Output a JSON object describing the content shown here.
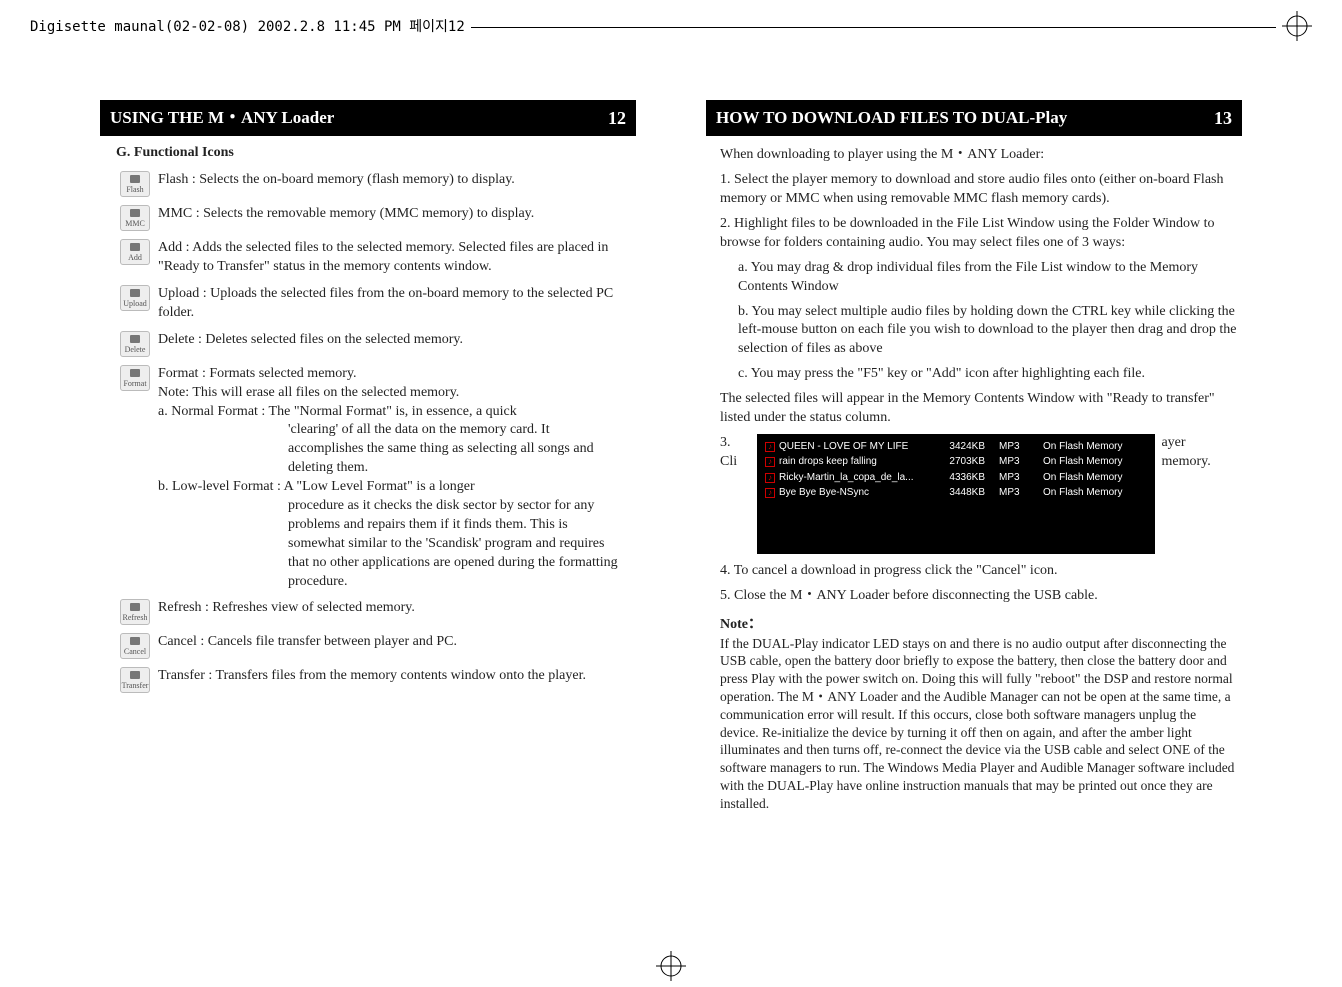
{
  "print_header": {
    "label": "Digisette maunal(02-02-08)  2002.2.8 11:45 PM  페이지12"
  },
  "left": {
    "header": {
      "title": "USING THE M・ANY Loader",
      "page": "12"
    },
    "section_title": "G. Functional Icons",
    "items": [
      {
        "icon_label": "Flash",
        "text": "Flash : Selects the on-board memory (flash memory) to display."
      },
      {
        "icon_label": "MMC",
        "text": "MMC : Selects the removable memory (MMC memory) to display."
      },
      {
        "icon_label": "Add",
        "text": "Add : Adds the selected files to the selected memory. Selected files are placed in \"Ready to Transfer\" status in the memory contents window."
      },
      {
        "icon_label": "Upload",
        "text": "Upload : Uploads the selected files from the on-board memory to the selected PC folder."
      },
      {
        "icon_label": "Delete",
        "text": "Delete : Deletes selected files on the selected memory."
      },
      {
        "icon_label": "Format",
        "text": "Format : Formats selected memory."
      },
      {
        "icon_label": "Refresh",
        "text": "Refresh : Refreshes view of selected memory."
      },
      {
        "icon_label": "Cancel",
        "text": "Cancel : Cancels file transfer between player and PC."
      },
      {
        "icon_label": "Transfer",
        "text": "Transfer : Transfers files from the memory contents window onto the player."
      }
    ],
    "format_note": "Note: This will erase all files on the selected memory.",
    "format_a_lead": "a. Normal Format : The \"Normal Format\" is, in essence, a quick",
    "format_a_body": "'clearing' of all the data on the memory card. It accomplishes the same thing as selecting all songs and deleting them.",
    "format_b_lead": "b. Low-level Format : A \"Low Level Format\" is a longer",
    "format_b_body": "procedure as it checks the disk sector by sector for any problems and repairs them if it finds them. This is somewhat similar to the 'Scandisk' program and requires that no other applications are opened during the formatting procedure."
  },
  "right": {
    "header": {
      "title": "HOW TO DOWNLOAD FILES TO DUAL-Play",
      "page": "13"
    },
    "intro": "When downloading to player using the M・ANY Loader:",
    "step1": "1. Select the player memory to download and store audio files onto (either on-board Flash memory or MMC when using removable MMC flash memory cards).",
    "step2": "2. Highlight files to be downloaded in the File List Window using the Folder Window to browse for folders containing audio. You may select files one of 3 ways:",
    "step2a": "a. You may drag & drop individual files from the File List window to the Memory Contents Window",
    "step2b": "b. You may select multiple audio files by holding down the CTRL key while clicking the left-mouse button on each file you wish to download to the player then drag and drop the selection of files as above",
    "step2c": "c. You may press the \"F5\" key or \"Add\" icon after highlighting each file.",
    "selected_para": "The selected files will appear in the Memory Contents Window with \"Ready to transfer\" listed under the status column.",
    "step3_prefix": "3. Cli",
    "step3_suffix": "ayer memory.",
    "screenshot_rows": [
      {
        "name": "QUEEN - LOVE OF MY LIFE",
        "size": "3424KB",
        "type": "MP3",
        "status": "On Flash Memory"
      },
      {
        "name": "rain drops keep falling",
        "size": "2703KB",
        "type": "MP3",
        "status": "On Flash Memory"
      },
      {
        "name": "Ricky-Martin_la_copa_de_la...",
        "size": "4336KB",
        "type": "MP3",
        "status": "On Flash Memory"
      },
      {
        "name": "Bye Bye Bye-NSync",
        "size": "3448KB",
        "type": "MP3",
        "status": "On Flash Memory"
      }
    ],
    "step4": "4. To cancel a download in progress click the \"Cancel\" icon.",
    "step5": "5. Close the M・ANY Loader before disconnecting the USB cable.",
    "note_head": "Note：",
    "note_body": "If the DUAL-Play indicator LED stays on and there is no audio output after disconnecting the USB cable, open the battery door briefly to expose the battery, then close the battery door and press Play with the power switch on. Doing this will fully \"reboot\" the DSP and restore normal operation. The M・ANY Loader and the Audible Manager can not be open at the same time, a communication error will result. If this occurs, close both software managers unplug the device. Re-initialize the device by turning it off then on again, and after the amber light illuminates and then turns off, re-connect the device via the USB cable and select ONE of the software managers to run. The Windows Media Player and Audible Manager software included with the DUAL-Play have online instruction manuals that may be printed out once they are installed."
  }
}
